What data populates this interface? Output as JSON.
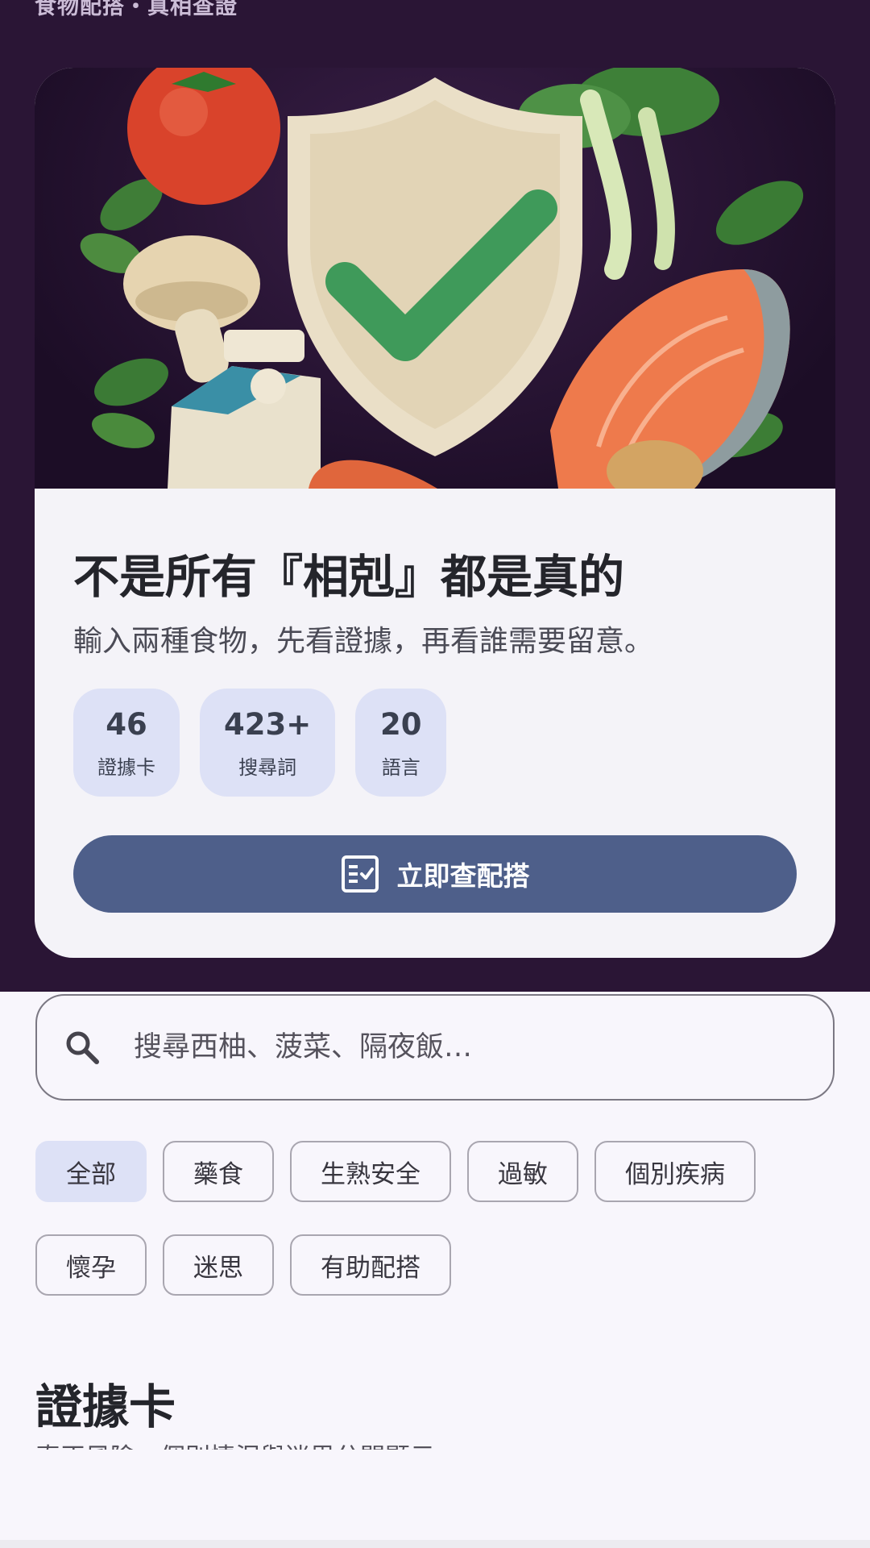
{
  "header": {
    "caption": "食物配搭・真相查證"
  },
  "hero": {
    "image_alt": "food-safety-illustration",
    "title": "不是所有『相剋』都是真的",
    "subtitle": "輸入兩種食物，先看證據，再看誰需要留意。",
    "stats": [
      {
        "value": "46",
        "label": "證據卡"
      },
      {
        "value": "423+",
        "label": "搜尋詞"
      },
      {
        "value": "20",
        "label": "語言"
      }
    ],
    "cta_label": "立即查配搭",
    "cta_icon": "checklist-icon"
  },
  "search": {
    "placeholder": "搜尋西柚、菠菜、隔夜飯…",
    "icon": "search-icon"
  },
  "filters": {
    "row1": [
      "全部",
      "藥食",
      "生熟安全",
      "過敏",
      "個別疾病"
    ],
    "row2": [
      "懷孕",
      "迷思",
      "有助配搭"
    ],
    "selected": "全部"
  },
  "section": {
    "title": "證據卡",
    "subtitle": "真正風險、個別情況與迷思分開顯示"
  },
  "colors": {
    "top_band": "#2a1535",
    "accent": "#4e5f8a",
    "chip_selected": "#dde1f6"
  }
}
